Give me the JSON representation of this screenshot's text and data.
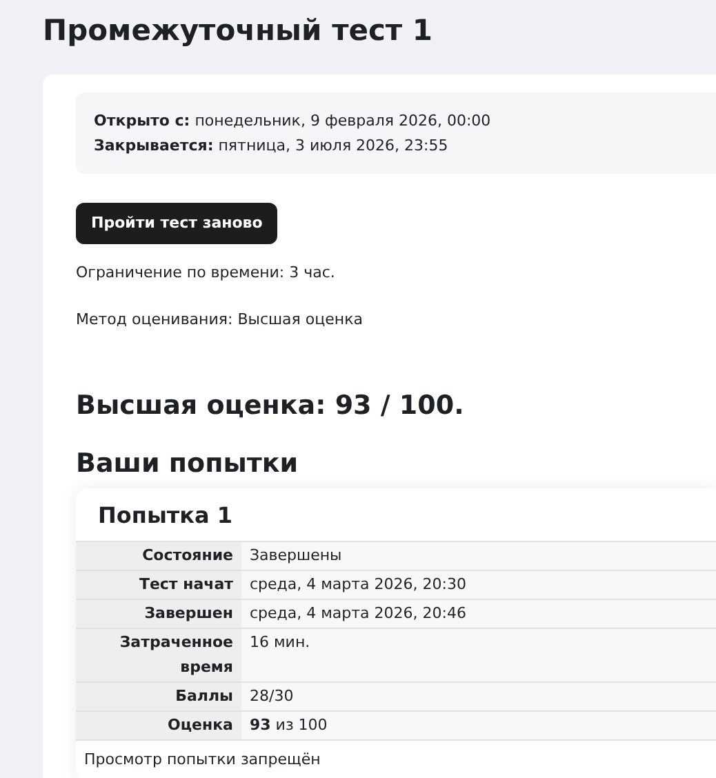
{
  "title": "Промежуточный тест 1",
  "dates": [
    {
      "label": "Открыто с:",
      "value": "понедельник, 9 февраля 2026, 00:00"
    },
    {
      "label": "Закрывается:",
      "value": "пятница, 3 июля 2026, 23:55"
    }
  ],
  "retake_button": "Пройти тест заново",
  "info": [
    "Ограничение по времени: 3 час.",
    "Метод оценивания: Высшая оценка"
  ],
  "best_grade": "Высшая оценка: 93 / 100.",
  "attempts_heading": "Ваши попытки",
  "attempt": {
    "title": "Попытка 1",
    "rows": [
      {
        "label": "Состояние",
        "value": "Завершены"
      },
      {
        "label": "Тест начат",
        "value": "среда, 4 марта 2026, 20:30"
      },
      {
        "label": "Завершен",
        "value": "среда, 4 марта 2026, 20:46"
      },
      {
        "label": "Затраченное время",
        "value": "16 мин."
      },
      {
        "label": "Баллы",
        "value": "28/30"
      },
      {
        "label": "Оценка",
        "value": "**93** из 100"
      }
    ],
    "note": "Просмотр попытки запрещён"
  }
}
